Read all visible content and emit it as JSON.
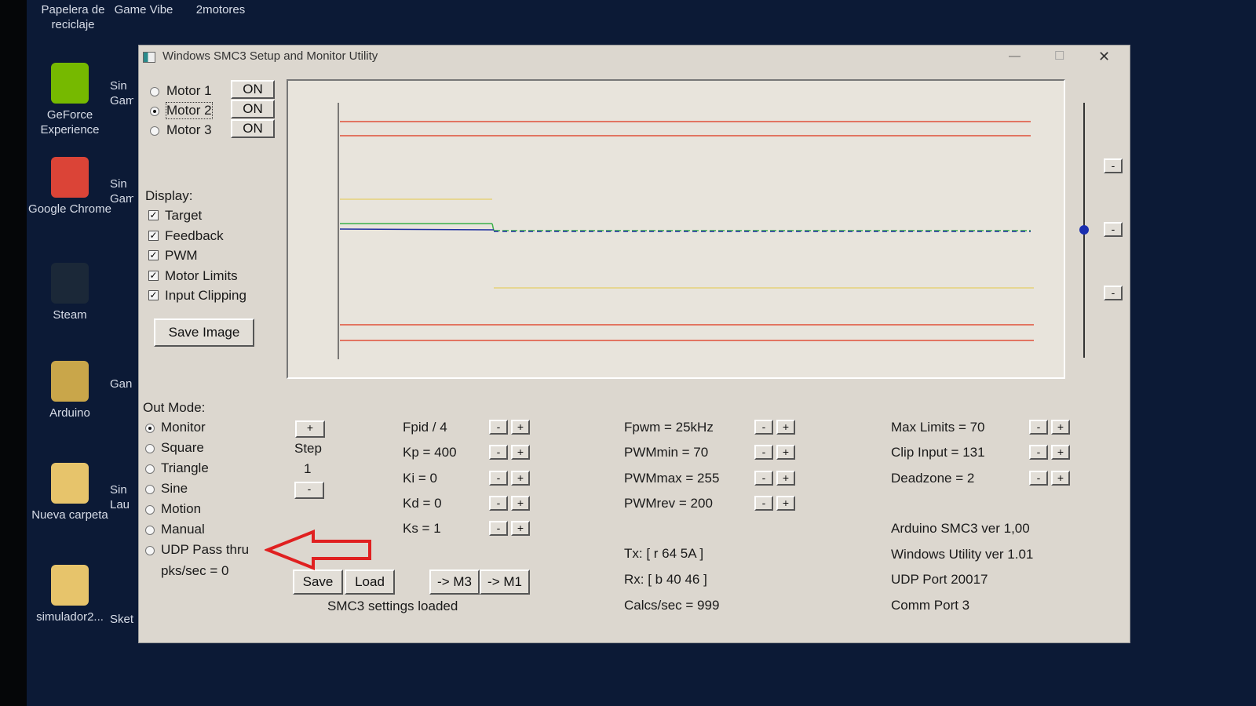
{
  "desktop": {
    "top_icons": [
      "Papelera de reciclaje",
      "Game Vibe",
      "2motores"
    ],
    "icons": [
      {
        "label": "GeForce Experience",
        "color": "#76b900"
      },
      {
        "label": "Google Chrome",
        "color": "#db4437"
      },
      {
        "label": "Steam",
        "color": "#1b2838"
      },
      {
        "label": "Arduino",
        "color": "#c9a64a"
      },
      {
        "label": "Nueva carpeta",
        "color": "#e7c46b"
      },
      {
        "label": "simulador2...",
        "color": "#e7c46b"
      }
    ],
    "partial_icons": [
      "Sin Gam",
      "Sin Gam",
      "Gan",
      "Sin Lau",
      "Sket"
    ]
  },
  "window": {
    "title": "Windows SMC3 Setup and Monitor Utility",
    "minimize": "—",
    "maximize": "☐",
    "close": "✕"
  },
  "motors": [
    {
      "label": "Motor 1",
      "state": "ON",
      "selected": false
    },
    {
      "label": "Motor 2",
      "state": "ON",
      "selected": true
    },
    {
      "label": "Motor 3",
      "state": "ON",
      "selected": false
    }
  ],
  "display": {
    "label": "Display:",
    "items": [
      "Target",
      "Feedback",
      "PWM",
      "Motor Limits",
      "Input Clipping"
    ],
    "save_image": "Save Image"
  },
  "out_mode": {
    "label": "Out Mode:",
    "items": [
      "Monitor",
      "Square",
      "Triangle",
      "Sine",
      "Motion",
      "Manual",
      "UDP Pass thru"
    ],
    "selected": "Monitor",
    "pks": "pks/sec = 0"
  },
  "step": {
    "plus": "+",
    "label": "Step",
    "value": "1",
    "minus": "-"
  },
  "pid": [
    "Fpid / 4",
    "Kp = 400",
    "Ki = 0",
    "Kd = 0",
    "Ks = 1"
  ],
  "pwm": [
    "Fpwm = 25kHz",
    "PWMmin = 70",
    "PWMmax = 255",
    "PWMrev = 200"
  ],
  "limits": [
    "Max Limits = 70",
    "Clip Input = 131",
    "Deadzone = 2"
  ],
  "buttons": {
    "save": "Save",
    "load": "Load",
    "to_m3": "-> M3",
    "to_m1": "-> M1",
    "minus": "-",
    "plus": "+"
  },
  "status": "SMC3 settings loaded",
  "comm": {
    "tx": "Tx: [ r 64 5A ]",
    "rx": "Rx: [ b 40 46 ]",
    "calcs": "Calcs/sec = 999"
  },
  "info": [
    "Arduino SMC3 ver 1,00",
    "Windows Utility ver 1.01",
    "UDP Port 20017",
    "Comm Port 3"
  ],
  "colors": {
    "limit": "#e0503a",
    "clip": "#e6d27a",
    "target": "#3ab04a",
    "feedback": "#2030a0",
    "accent": "#1a2fb0",
    "arrow": "#e02020"
  }
}
